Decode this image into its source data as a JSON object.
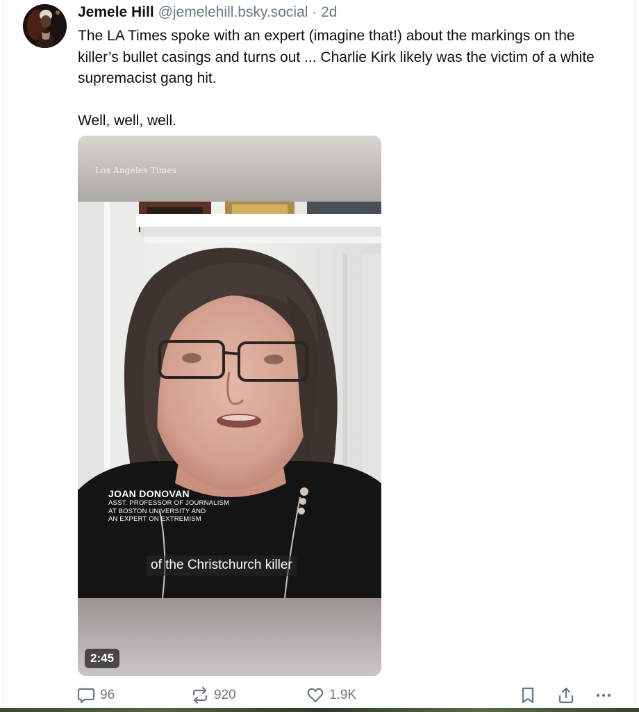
{
  "post": {
    "display_name": "Jemele Hill",
    "handle": "@jemelehill.bsky.social",
    "time_separator": " · ",
    "time_ago": "2d",
    "text_paragraph_1": "The LA Times spoke with an expert (imagine that!) about the markings on the killer’s bullet casings and turns out ... Charlie Kirk likely was the victim of a white supremacist gang hit.",
    "text_paragraph_2": "Well, well, well."
  },
  "video": {
    "source_logo": "Los Angeles Times",
    "lower_third_name": "JOAN DONOVAN",
    "lower_third_title_1": "ASST. PROFESSOR OF JOURNALISM",
    "lower_third_title_2": "AT BOSTON UNIVERSITY AND",
    "lower_third_title_3": "AN EXPERT ON EXTREMISM",
    "caption": "of the Christchurch killer",
    "duration": "2:45"
  },
  "actions": {
    "reply_count": "96",
    "repost_count": "920",
    "like_count": "1.9K",
    "icons": [
      "reply-icon",
      "repost-icon",
      "like-icon",
      "bookmark-icon",
      "share-icon",
      "more-icon"
    ]
  },
  "colors": {
    "text": "#0b0f14",
    "muted": "#6b7785",
    "background": "#ffffff"
  }
}
